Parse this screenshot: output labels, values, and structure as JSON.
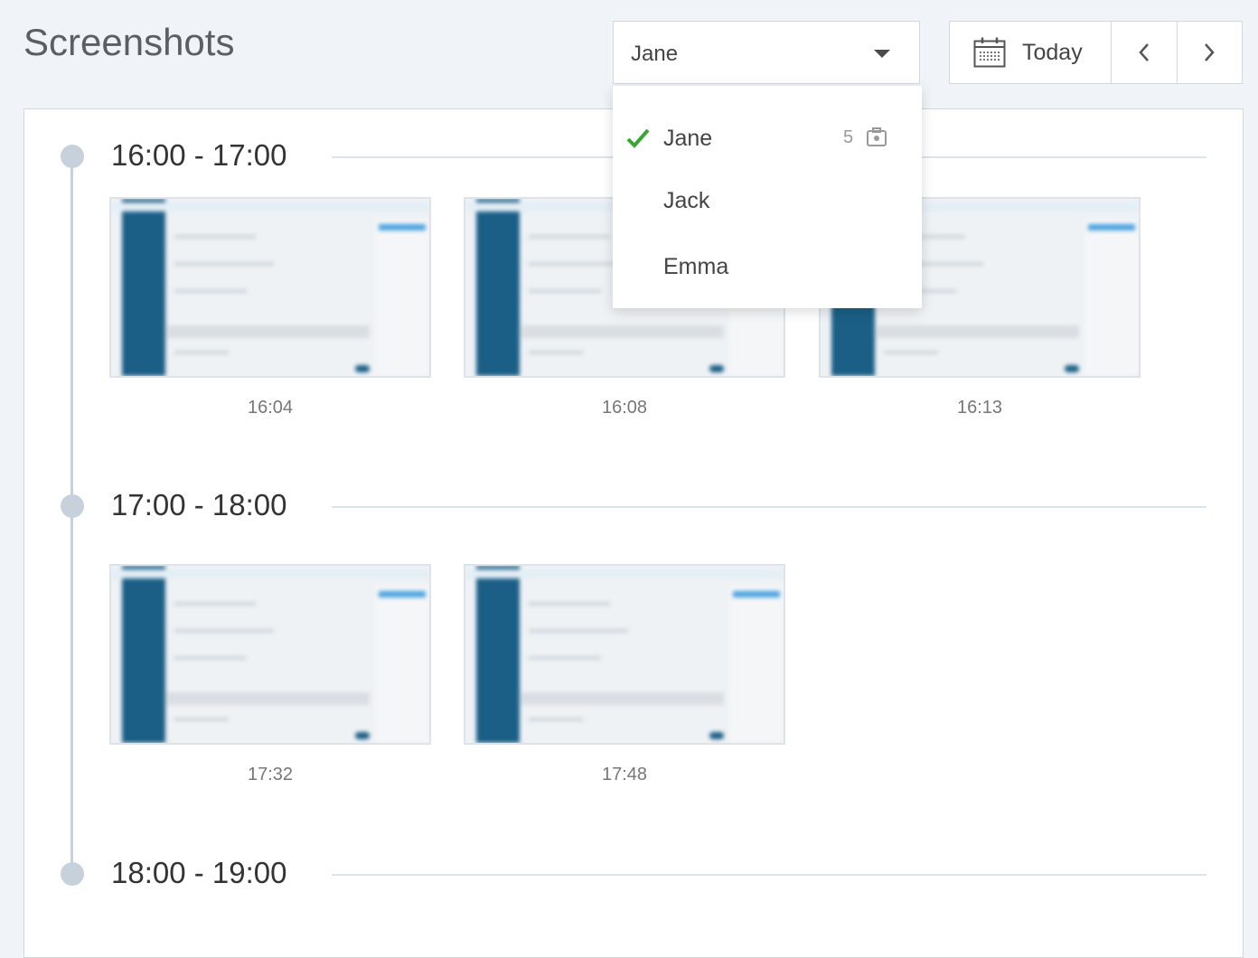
{
  "page_title": "Screenshots",
  "user_select": {
    "value": "Jane"
  },
  "date_nav": {
    "today_label": "Today"
  },
  "dropdown": {
    "items": [
      {
        "name": "Jane",
        "selected": true,
        "count": "5"
      },
      {
        "name": "Jack"
      },
      {
        "name": "Emma"
      }
    ]
  },
  "hours": [
    {
      "label": "16:00 - 17:00",
      "screenshots": [
        {
          "time": "16:04"
        },
        {
          "time": "16:08"
        },
        {
          "time": "16:13"
        }
      ]
    },
    {
      "label": "17:00 - 18:00",
      "screenshots": [
        {
          "time": "17:32"
        },
        {
          "time": "17:48"
        }
      ]
    },
    {
      "label": "18:00 - 19:00",
      "screenshots": []
    }
  ],
  "colors": {
    "accent_blue": "#1b5f86",
    "check_green": "#3aa535",
    "timeline": "#c6d1db"
  }
}
